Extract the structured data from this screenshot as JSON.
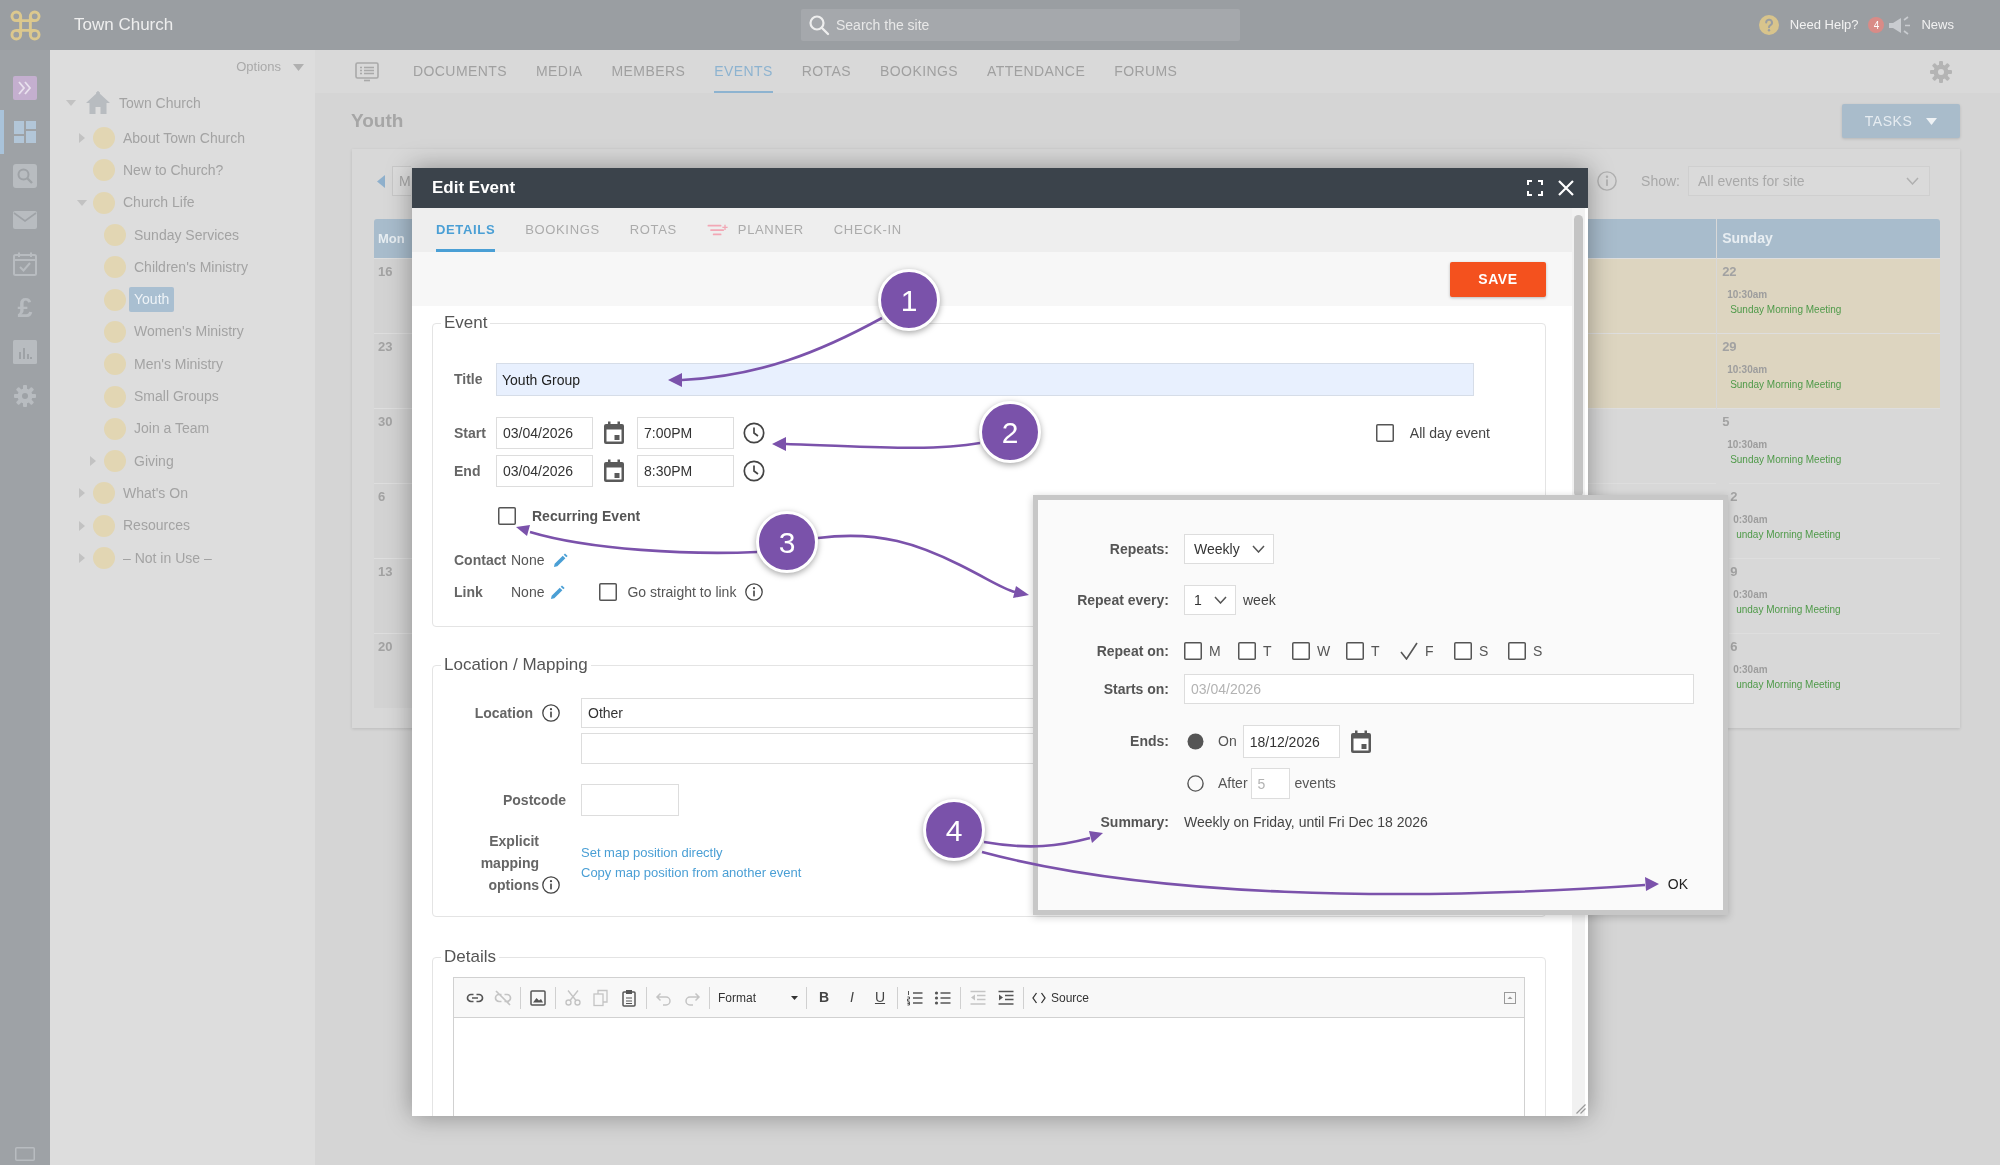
{
  "top_bar": {
    "site_name": "Town Church",
    "search": {
      "placeholder": "Search the site"
    },
    "help_label": "Need Help?",
    "notification_count": "4",
    "news_label": "News"
  },
  "icon_rail": {
    "items": [
      {
        "selected": false
      },
      {
        "selected": true
      },
      {
        "selected": false
      },
      {
        "selected": false
      },
      {
        "selected": false
      },
      {
        "selected": false,
        "glyph": "£"
      },
      {
        "selected": false
      },
      {
        "selected": false
      }
    ]
  },
  "sidebar": {
    "options_label": "Options",
    "tree": [
      {
        "label": "Town Church",
        "kind": "site",
        "expanded": true,
        "selected": false,
        "children": [
          {
            "label": "About Town Church",
            "kind": "page",
            "expanded": false,
            "selected": false
          },
          {
            "label": "New to Church?",
            "kind": "page",
            "selected": false
          },
          {
            "label": "Church Life",
            "kind": "page",
            "expanded": true,
            "selected": false,
            "children": [
              {
                "label": "Sunday Services",
                "kind": "page",
                "selected": false
              },
              {
                "label": "Children's Ministry",
                "kind": "page",
                "selected": false
              },
              {
                "label": "Youth",
                "kind": "page",
                "selected": true
              },
              {
                "label": "Women's Ministry",
                "kind": "page",
                "selected": false
              },
              {
                "label": "Men's Ministry",
                "kind": "page",
                "selected": false
              },
              {
                "label": "Small Groups",
                "kind": "page",
                "selected": false
              },
              {
                "label": "Join a Team",
                "kind": "page",
                "selected": false
              },
              {
                "label": "Giving",
                "kind": "page",
                "expanded": false,
                "selected": false
              }
            ]
          },
          {
            "label": "What's On",
            "kind": "page",
            "expanded": false,
            "selected": false
          },
          {
            "label": "Resources",
            "kind": "page",
            "expanded": false,
            "selected": false
          },
          {
            "label": "– Not in Use –",
            "kind": "page",
            "expanded": false,
            "selected": false
          }
        ]
      }
    ]
  },
  "nav_tabs": [
    {
      "label": "DOCUMENTS",
      "selected": false
    },
    {
      "label": "MEDIA",
      "selected": false
    },
    {
      "label": "MEMBERS",
      "selected": false
    },
    {
      "label": "EVENTS",
      "selected": true
    },
    {
      "label": "ROTAS",
      "selected": false
    },
    {
      "label": "BOOKINGS",
      "selected": false
    },
    {
      "label": "ATTENDANCE",
      "selected": false
    },
    {
      "label": "FORUMS",
      "selected": false
    }
  ],
  "page_title": "Youth",
  "tasks_button": "TASKS",
  "calendar": {
    "period_select": {
      "value": "M"
    },
    "show_label": "Show:",
    "show_select": {
      "value": "All events for site"
    },
    "columns": [
      "Mon",
      "Sunday"
    ],
    "weeks": [
      {
        "monday": "16",
        "sunday": "22",
        "highlighted": true,
        "events": [
          {
            "time": "10:30am",
            "title": "Sunday Morning Meeting"
          }
        ]
      },
      {
        "monday": "23",
        "sunday": "29",
        "highlighted": true,
        "events": [
          {
            "time": "10:30am",
            "title": "Sunday Morning Meeting"
          }
        ]
      },
      {
        "monday": "30",
        "sunday": "5",
        "highlighted": false,
        "events": [
          {
            "time": "10:30am",
            "title": "Sunday Morning Meeting"
          }
        ]
      },
      {
        "monday": "6",
        "sunday": "2",
        "highlighted": false,
        "events": [
          {
            "time": "0:30am",
            "title": "unday Morning Meeting"
          }
        ]
      },
      {
        "monday": "13",
        "sunday": "9",
        "highlighted": false,
        "events": [
          {
            "time": "0:30am",
            "title": "unday Morning Meeting"
          }
        ]
      },
      {
        "monday": "20",
        "sunday": "6",
        "highlighted": false,
        "events": [
          {
            "time": "0:30am",
            "title": "unday Morning Meeting"
          }
        ]
      }
    ]
  },
  "edit_event": {
    "title": "Edit Event",
    "tabs": [
      {
        "label": "DETAILS",
        "selected": true,
        "has_icon": false
      },
      {
        "label": "BOOKINGS",
        "selected": false,
        "has_icon": false
      },
      {
        "label": "ROTAS",
        "selected": false,
        "has_icon": false
      },
      {
        "label": "PLANNER",
        "selected": false,
        "has_icon": true
      },
      {
        "label": "CHECK-IN",
        "selected": false,
        "has_icon": false
      }
    ],
    "save_button": "SAVE",
    "event_section": {
      "legend": "Event",
      "title_field": {
        "label": "Title",
        "value": "Youth Group"
      },
      "start": {
        "label": "Start",
        "date": "03/04/2026",
        "time": "7:00PM"
      },
      "end": {
        "label": "End",
        "date": "03/04/2026",
        "time": "8:30PM"
      },
      "all_day": {
        "label": "All day event",
        "checked": false
      },
      "recurring": {
        "label": "Recurring Event",
        "checked": false
      },
      "contact": {
        "label": "Contact",
        "value": "None"
      },
      "link": {
        "label": "Link",
        "value": "None"
      },
      "go_straight": {
        "label": "Go straight to link",
        "checked": false
      }
    },
    "location_section": {
      "legend": "Location / Mapping",
      "location": {
        "label": "Location",
        "value": "Other"
      },
      "postcode": {
        "label": "Postcode"
      },
      "mapping": {
        "label": "Explicit mapping options",
        "links": [
          "Set map position directly",
          "Copy map position from another event"
        ]
      }
    },
    "details_section": {
      "legend": "Details",
      "tools": [
        {
          "disabled": false
        },
        {
          "disabled": true
        },
        {
          "disabled": false
        },
        {
          "disabled": true
        },
        {
          "disabled": true
        },
        {
          "disabled": false
        },
        {
          "disabled": true
        },
        {
          "disabled": true
        }
      ],
      "format_label": "Format",
      "style_buttons": [
        {
          "label": "B"
        },
        {
          "label": "I"
        },
        {
          "label": "U"
        }
      ],
      "list_tools": [
        {
          "disabled": false
        },
        {
          "disabled": false
        },
        {
          "disabled": true
        },
        {
          "disabled": false
        }
      ],
      "source_label": "Source"
    }
  },
  "recurrence_popup": {
    "repeats": {
      "label": "Repeats:",
      "value": "Weekly"
    },
    "repeat_every": {
      "label": "Repeat every:",
      "value": "1",
      "unit": "week"
    },
    "repeat_on": {
      "label": "Repeat on:",
      "days": [
        {
          "label": "M",
          "checked": false
        },
        {
          "label": "T",
          "checked": false
        },
        {
          "label": "W",
          "checked": false
        },
        {
          "label": "T",
          "checked": false
        },
        {
          "label": "F",
          "checked": true
        },
        {
          "label": "S",
          "checked": false
        },
        {
          "label": "S",
          "checked": false
        }
      ]
    },
    "starts_on": {
      "label": "Starts on:",
      "value": "03/04/2026",
      "disabled": true
    },
    "ends": {
      "label": "Ends:",
      "options": [
        {
          "kind": "on",
          "label": "On",
          "value": "18/12/2026",
          "selected": true
        },
        {
          "kind": "after",
          "label": "After",
          "value": "5",
          "suffix": "events",
          "selected": false
        }
      ]
    },
    "summary": {
      "label": "Summary:",
      "text": "Weekly on Friday, until Fri Dec 18 2026"
    },
    "ok_button": "OK"
  },
  "annotations": [
    {
      "label": "1"
    },
    {
      "label": "2"
    },
    {
      "label": "3"
    },
    {
      "label": "4"
    }
  ]
}
